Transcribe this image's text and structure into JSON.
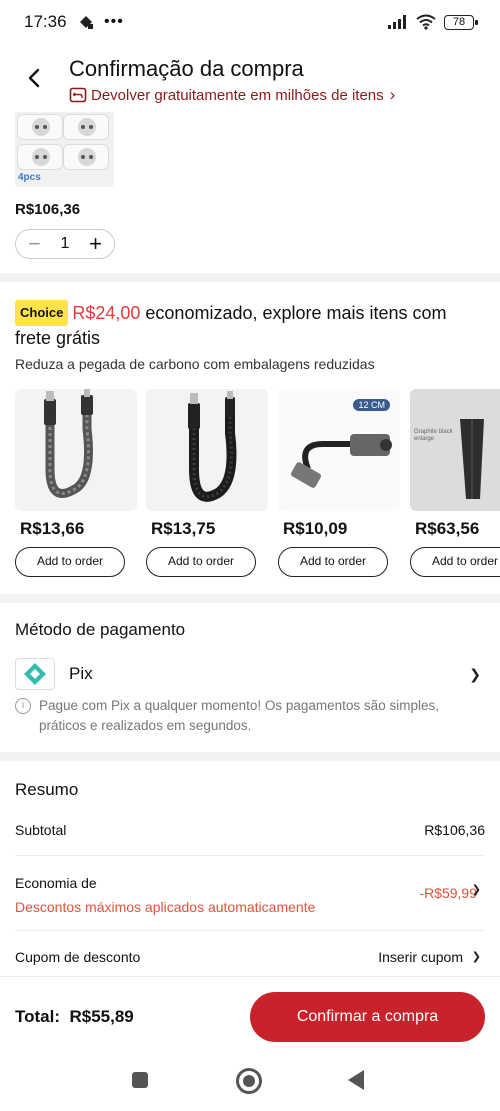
{
  "status_bar": {
    "time": "17:36",
    "battery": "78"
  },
  "header": {
    "title": "Confirmação da compra",
    "return_text": "Devolver gratuitamente em milhões de itens",
    "return_chevron": "›"
  },
  "product": {
    "pcs": "4pcs",
    "price": "R$106,36",
    "quantity": "1",
    "minus": "−",
    "plus": "+"
  },
  "choice": {
    "badge": "Choice",
    "amount": "R$24,00",
    "text": " economizado, explore mais itens com frete grátis",
    "subtitle": "Reduza a pegada de carbono com embalagens reduzidas"
  },
  "recommendations": [
    {
      "price": "R$13,66",
      "add_label": "Add to order",
      "icon": "usb-cable-gray"
    },
    {
      "price": "R$13,75",
      "add_label": "Add to order",
      "icon": "usb-cable-black"
    },
    {
      "price": "R$10,09",
      "add_label": "Add to order",
      "icon": "audio-adapter",
      "badge": "12 CM"
    },
    {
      "price": "R$63,56",
      "add_label": "Add to order",
      "icon": "umbrella",
      "badge": "Graphite black enlarge"
    }
  ],
  "payment": {
    "title": "Método de pagamento",
    "method": "Pix",
    "info": "Pague com Pix a qualquer momento! Os pagamentos são simples, práticos e realizados em segundos."
  },
  "summary": {
    "title": "Resumo",
    "subtotal_label": "Subtotal",
    "subtotal_value": "R$106,36",
    "savings_label": "Economia de",
    "savings_desc": "Descontos máximos aplicados automaticamente",
    "savings_value": "-R$59,99",
    "coupon_label": "Cupom de desconto",
    "coupon_action": "Inserir cupom"
  },
  "footer": {
    "total_label": "Total:",
    "total_value": "R$55,89",
    "confirm_label": "Confirmar a compra"
  },
  "colors": {
    "accent": "#c8222a",
    "discount": "#e0523a",
    "choice_badge": "#ffe34d"
  }
}
